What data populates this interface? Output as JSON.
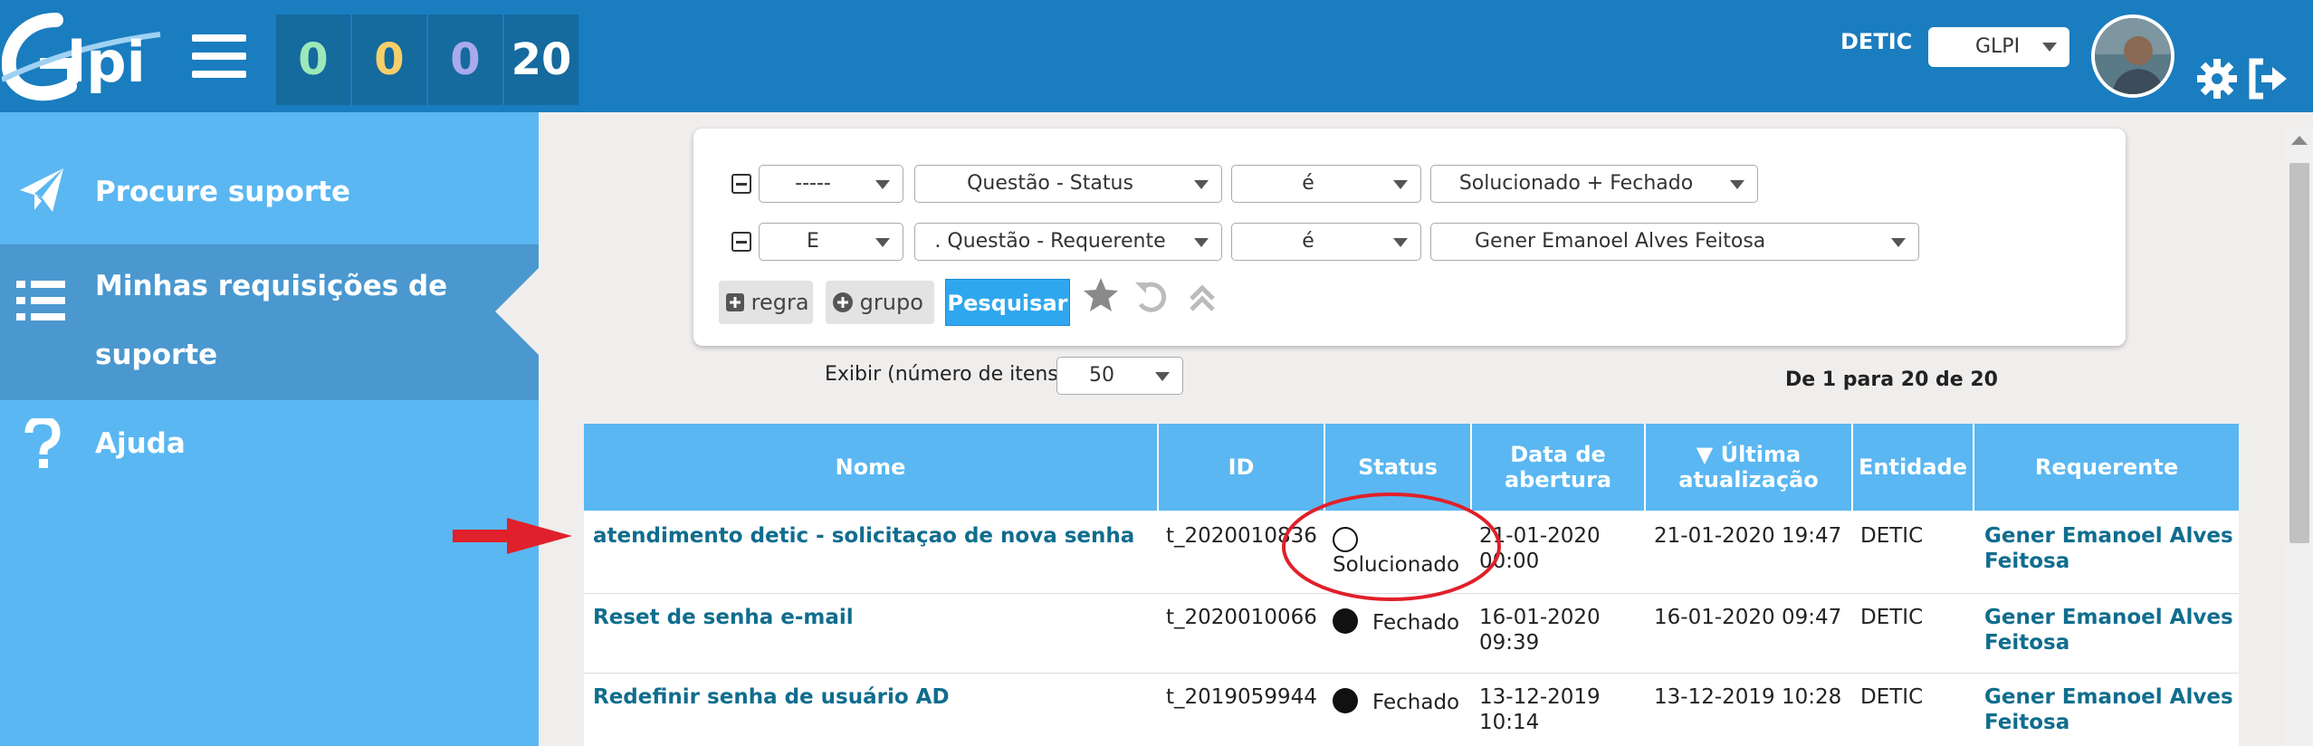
{
  "header": {
    "counters": [
      {
        "value": "0",
        "color": "#9de8b9"
      },
      {
        "value": "0",
        "color": "#f6cf6a"
      },
      {
        "value": "0",
        "color": "#a9a9ee"
      },
      {
        "value": "20",
        "color": "#ffffff"
      }
    ],
    "entity": "DETIC",
    "profile": "GLPI"
  },
  "sidebar": {
    "items": [
      {
        "label": "Procure suporte",
        "icon": "paper-plane-icon"
      },
      {
        "label_line1": "Minhas requisições de",
        "label_line2": "suporte",
        "icon": "list-icon",
        "active": true
      },
      {
        "label": "Ajuda",
        "icon": "question-icon"
      }
    ]
  },
  "search": {
    "rows": [
      {
        "link": "-----",
        "field": "Questão - Status",
        "op": "é",
        "value": "Solucionado + Fechado"
      },
      {
        "link": "E",
        "field": ". Questão - Requerente",
        "op": "é",
        "value": "Gener Emanoel Alves Feitosa"
      }
    ],
    "add_rule": "regra",
    "add_group": "grupo",
    "submit": "Pesquisar"
  },
  "list": {
    "display_label": "Exibir (número de itens)",
    "display_value": "50",
    "pager": "De 1 para 20 de 20",
    "columns": [
      "Nome",
      "ID",
      "Status",
      "Data de abertura",
      "▼ Última atualização",
      "Entidade",
      "Requerente"
    ],
    "rows": [
      {
        "name": "atendimento detic - solicitaçao de nova senha",
        "id": "t_2020010836",
        "status": "Solucionado",
        "opened1": "21-01-2020",
        "opened2": "00:00",
        "updated": "21-01-2020 19:47",
        "entity": "DETIC",
        "requester1": "Gener Emanoel Alves",
        "requester2": "Feitosa"
      },
      {
        "name": "Reset de senha e-mail",
        "id": "t_2020010066",
        "status": "Fechado",
        "opened1": "16-01-2020",
        "opened2": "09:39",
        "updated": "16-01-2020 09:47",
        "entity": "DETIC",
        "requester1": "Gener Emanoel Alves",
        "requester2": "Feitosa"
      },
      {
        "name": "Redefinir senha de usuário AD",
        "id": "t_2019059944",
        "status": "Fechado",
        "opened1": "13-12-2019",
        "opened2": "10:14",
        "updated": "13-12-2019 10:28",
        "entity": "DETIC",
        "requester1": "Gener Emanoel Alves",
        "requester2": "Feitosa"
      }
    ]
  },
  "colors": {
    "header": "#1a7dbf",
    "sidebar": "#5ab7f2",
    "link": "#106d8e",
    "annotation": "#e0202a"
  }
}
